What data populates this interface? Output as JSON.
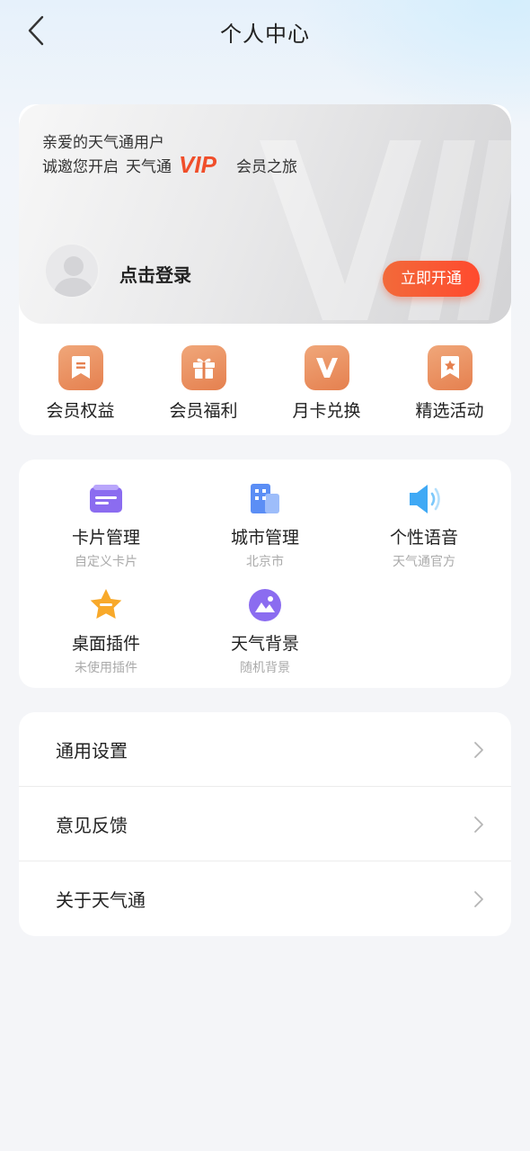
{
  "header": {
    "title": "个人中心"
  },
  "vip": {
    "greeting": "亲爱的天气通用户",
    "invite_prefix": "诚邀您开启",
    "invite_brand": "天气通",
    "invite_suffix": "会员之旅",
    "logo_text": "VIP",
    "login_label": "点击登录",
    "open_button": "立即开通"
  },
  "vip_actions": [
    {
      "label": "会员权益",
      "icon": "bookmark-icon"
    },
    {
      "label": "会员福利",
      "icon": "gift-icon"
    },
    {
      "label": "月卡兑换",
      "icon": "v-icon"
    },
    {
      "label": "精选活动",
      "icon": "star-badge-icon"
    }
  ],
  "tools": [
    {
      "label": "卡片管理",
      "sub": "自定义卡片",
      "icon": "card-icon"
    },
    {
      "label": "城市管理",
      "sub": "北京市",
      "icon": "building-icon"
    },
    {
      "label": "个性语音",
      "sub": "天气通官方",
      "icon": "speaker-icon"
    },
    {
      "label": "桌面插件",
      "sub": "未使用插件",
      "icon": "star-plugin-icon"
    },
    {
      "label": "天气背景",
      "sub": "随机背景",
      "icon": "image-icon"
    }
  ],
  "settings": [
    {
      "label": "通用设置"
    },
    {
      "label": "意见反馈"
    },
    {
      "label": "关于天气通"
    }
  ],
  "colors": {
    "accent_orange": "#ff4a2e",
    "vip_icon_orange": "#e5804f",
    "page_bg": "#f4f5f8"
  }
}
